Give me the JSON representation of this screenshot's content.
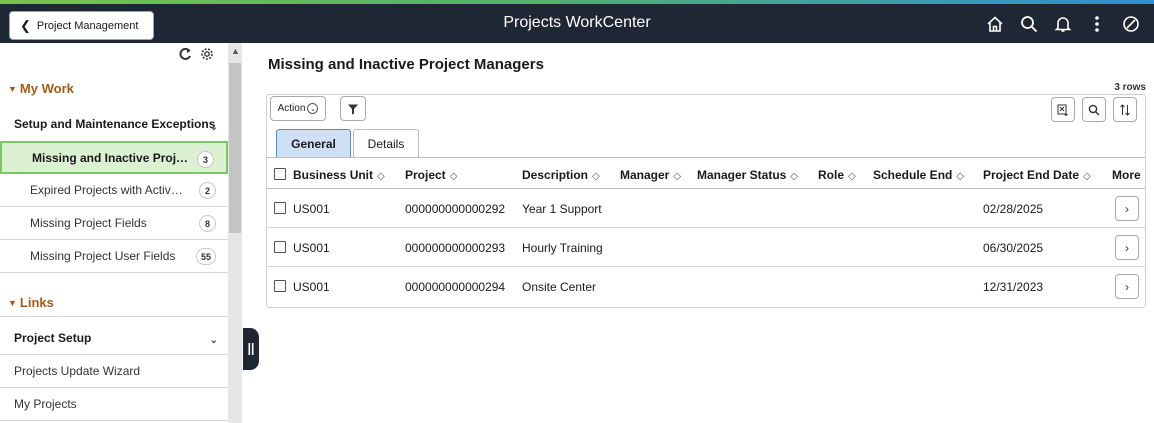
{
  "banner": {
    "back_label": "Project Management",
    "title": "Projects WorkCenter",
    "icons": [
      "home-icon",
      "search-icon",
      "bell-icon",
      "more-vertical-icon",
      "nav-compass-icon"
    ]
  },
  "left_panel": {
    "my_work": {
      "label": "My Work",
      "group": "Setup and Maintenance Exceptions",
      "items": [
        {
          "label": "Missing and Inactive Proje...",
          "count": "3"
        },
        {
          "label": "Expired Projects with Active ...",
          "count": "2"
        },
        {
          "label": "Missing Project Fields",
          "count": "8"
        },
        {
          "label": "Missing Project User Fields",
          "count": "55"
        }
      ]
    },
    "links": {
      "label": "Links",
      "group": "Project Setup",
      "items": [
        {
          "label": "Projects Update Wizard"
        },
        {
          "label": "My Projects"
        }
      ]
    }
  },
  "main": {
    "title": "Missing and Inactive Project Managers",
    "rows_count": "3 rows",
    "action_label": "Action",
    "tabs": [
      {
        "label": "General"
      },
      {
        "label": "Details"
      }
    ],
    "columns": [
      "Business Unit",
      "Project",
      "Description",
      "Manager",
      "Manager Status",
      "Role",
      "Schedule End",
      "Project End Date",
      "More"
    ],
    "rows": [
      {
        "business_unit": "US001",
        "project": "000000000000292",
        "description": "Year 1 Support",
        "project_end_date": "02/28/2025"
      },
      {
        "business_unit": "US001",
        "project": "000000000000293",
        "description": "Hourly Training",
        "project_end_date": "06/30/2025"
      },
      {
        "business_unit": "US001",
        "project": "000000000000294",
        "description": "Onsite Center",
        "project_end_date": "12/31/2023"
      }
    ]
  },
  "colors": {
    "banner_bg": "#1f2634",
    "active_item_bg": "#dcf0d2",
    "active_item_border": "#7cc466",
    "section_heading": "#a55a12",
    "active_tab_bg": "#cfe0f5"
  }
}
